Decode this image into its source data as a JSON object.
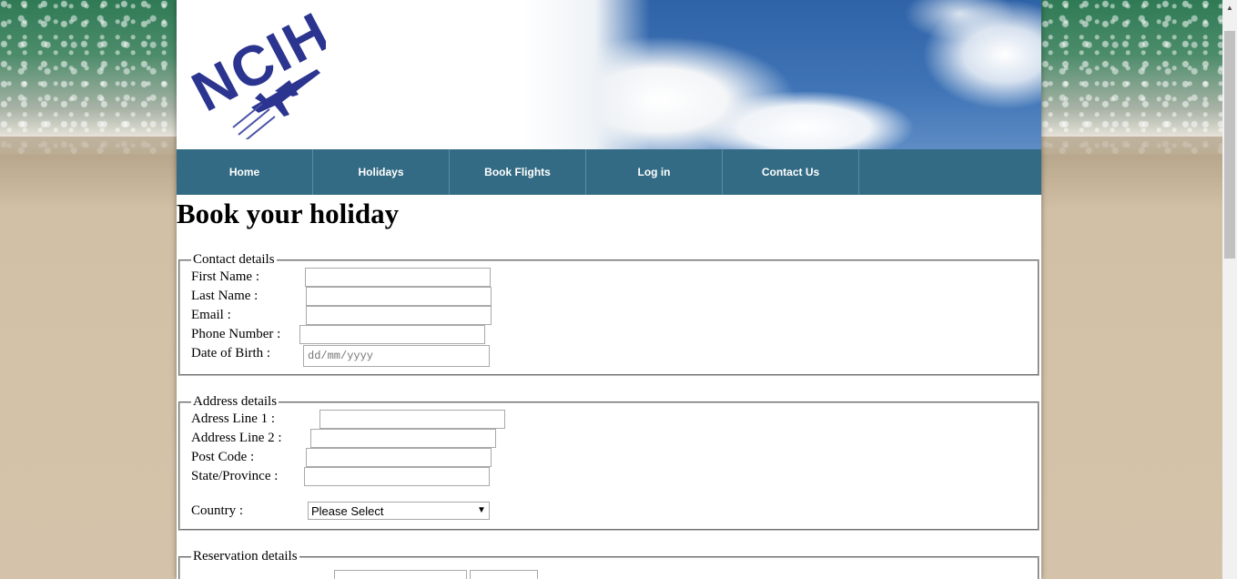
{
  "logo": {
    "text": "NCIH"
  },
  "nav": {
    "items": [
      {
        "label": "Home"
      },
      {
        "label": "Holidays"
      },
      {
        "label": "Book Flights"
      },
      {
        "label": "Log in"
      },
      {
        "label": "Contact Us"
      }
    ]
  },
  "page": {
    "title": "Book your holiday"
  },
  "contact": {
    "legend": "Contact details",
    "first_name": {
      "label": "First Name :",
      "value": ""
    },
    "last_name": {
      "label": "Last Name :",
      "value": ""
    },
    "email": {
      "label": "Email :",
      "value": ""
    },
    "phone": {
      "label": "Phone Number :",
      "value": ""
    },
    "dob": {
      "label": "Date of Birth :",
      "placeholder": "dd/mm/yyyy"
    }
  },
  "address": {
    "legend": "Address details",
    "line1": {
      "label": "Adress Line 1 :",
      "value": ""
    },
    "line2": {
      "label": "Address Line 2 :",
      "value": ""
    },
    "post_code": {
      "label": "Post Code :",
      "value": ""
    },
    "state": {
      "label": "State/Province :",
      "value": ""
    },
    "country": {
      "label": "Country :",
      "selected": "Please Select"
    }
  },
  "reservation": {
    "legend": "Reservation details"
  },
  "colors": {
    "nav_bg": "#336b84",
    "nav_text": "#ffffff",
    "logo_blue": "#2b3590"
  }
}
